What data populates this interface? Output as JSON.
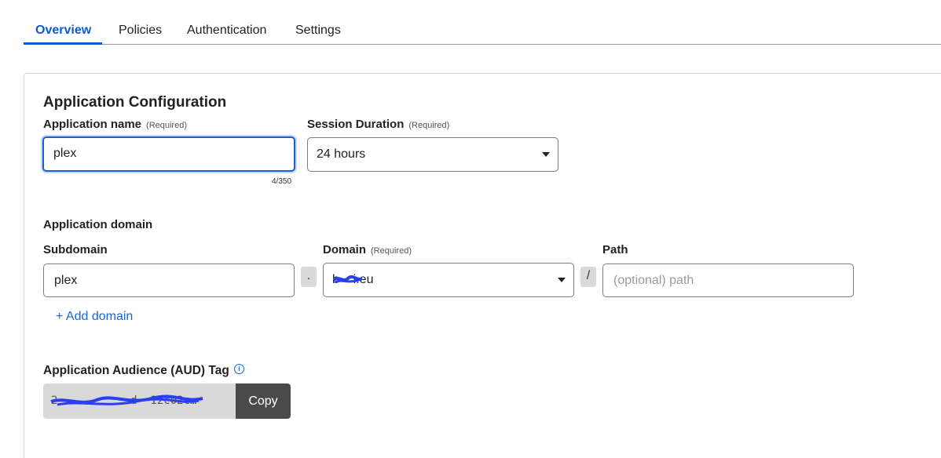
{
  "tabs": [
    {
      "label": "Overview",
      "active": true
    },
    {
      "label": "Policies",
      "active": false
    },
    {
      "label": "Authentication",
      "active": false
    },
    {
      "label": "Settings",
      "active": false
    }
  ],
  "section_title": "Application Configuration",
  "app_name": {
    "label": "Application name",
    "required": "(Required)",
    "value": "plex",
    "counter": "4/350"
  },
  "session_duration": {
    "label": "Session Duration",
    "required": "(Required)",
    "value": "24 hours"
  },
  "app_domain": {
    "heading": "Application domain",
    "subdomain_label": "Subdomain",
    "subdomain_value": "plex",
    "dot_separator": ".",
    "domain_label": "Domain",
    "domain_required": "(Required)",
    "domain_value": "b    i.eu",
    "slash_separator": "/",
    "path_label": "Path",
    "path_placeholder": "(optional) path",
    "add_domain": "+ Add domain"
  },
  "aud": {
    "label": "Application Audience (AUD) Tag",
    "value_visible": "2           d  12c02c…",
    "copy_label": "Copy",
    "info_icon": "info-icon"
  },
  "colors": {
    "accent": "#0b5cc7",
    "link": "#1a66d6",
    "focus_ring": "#1a5fd0",
    "copy_button": "#4a4a4a",
    "redaction": "#2a3ff0"
  }
}
